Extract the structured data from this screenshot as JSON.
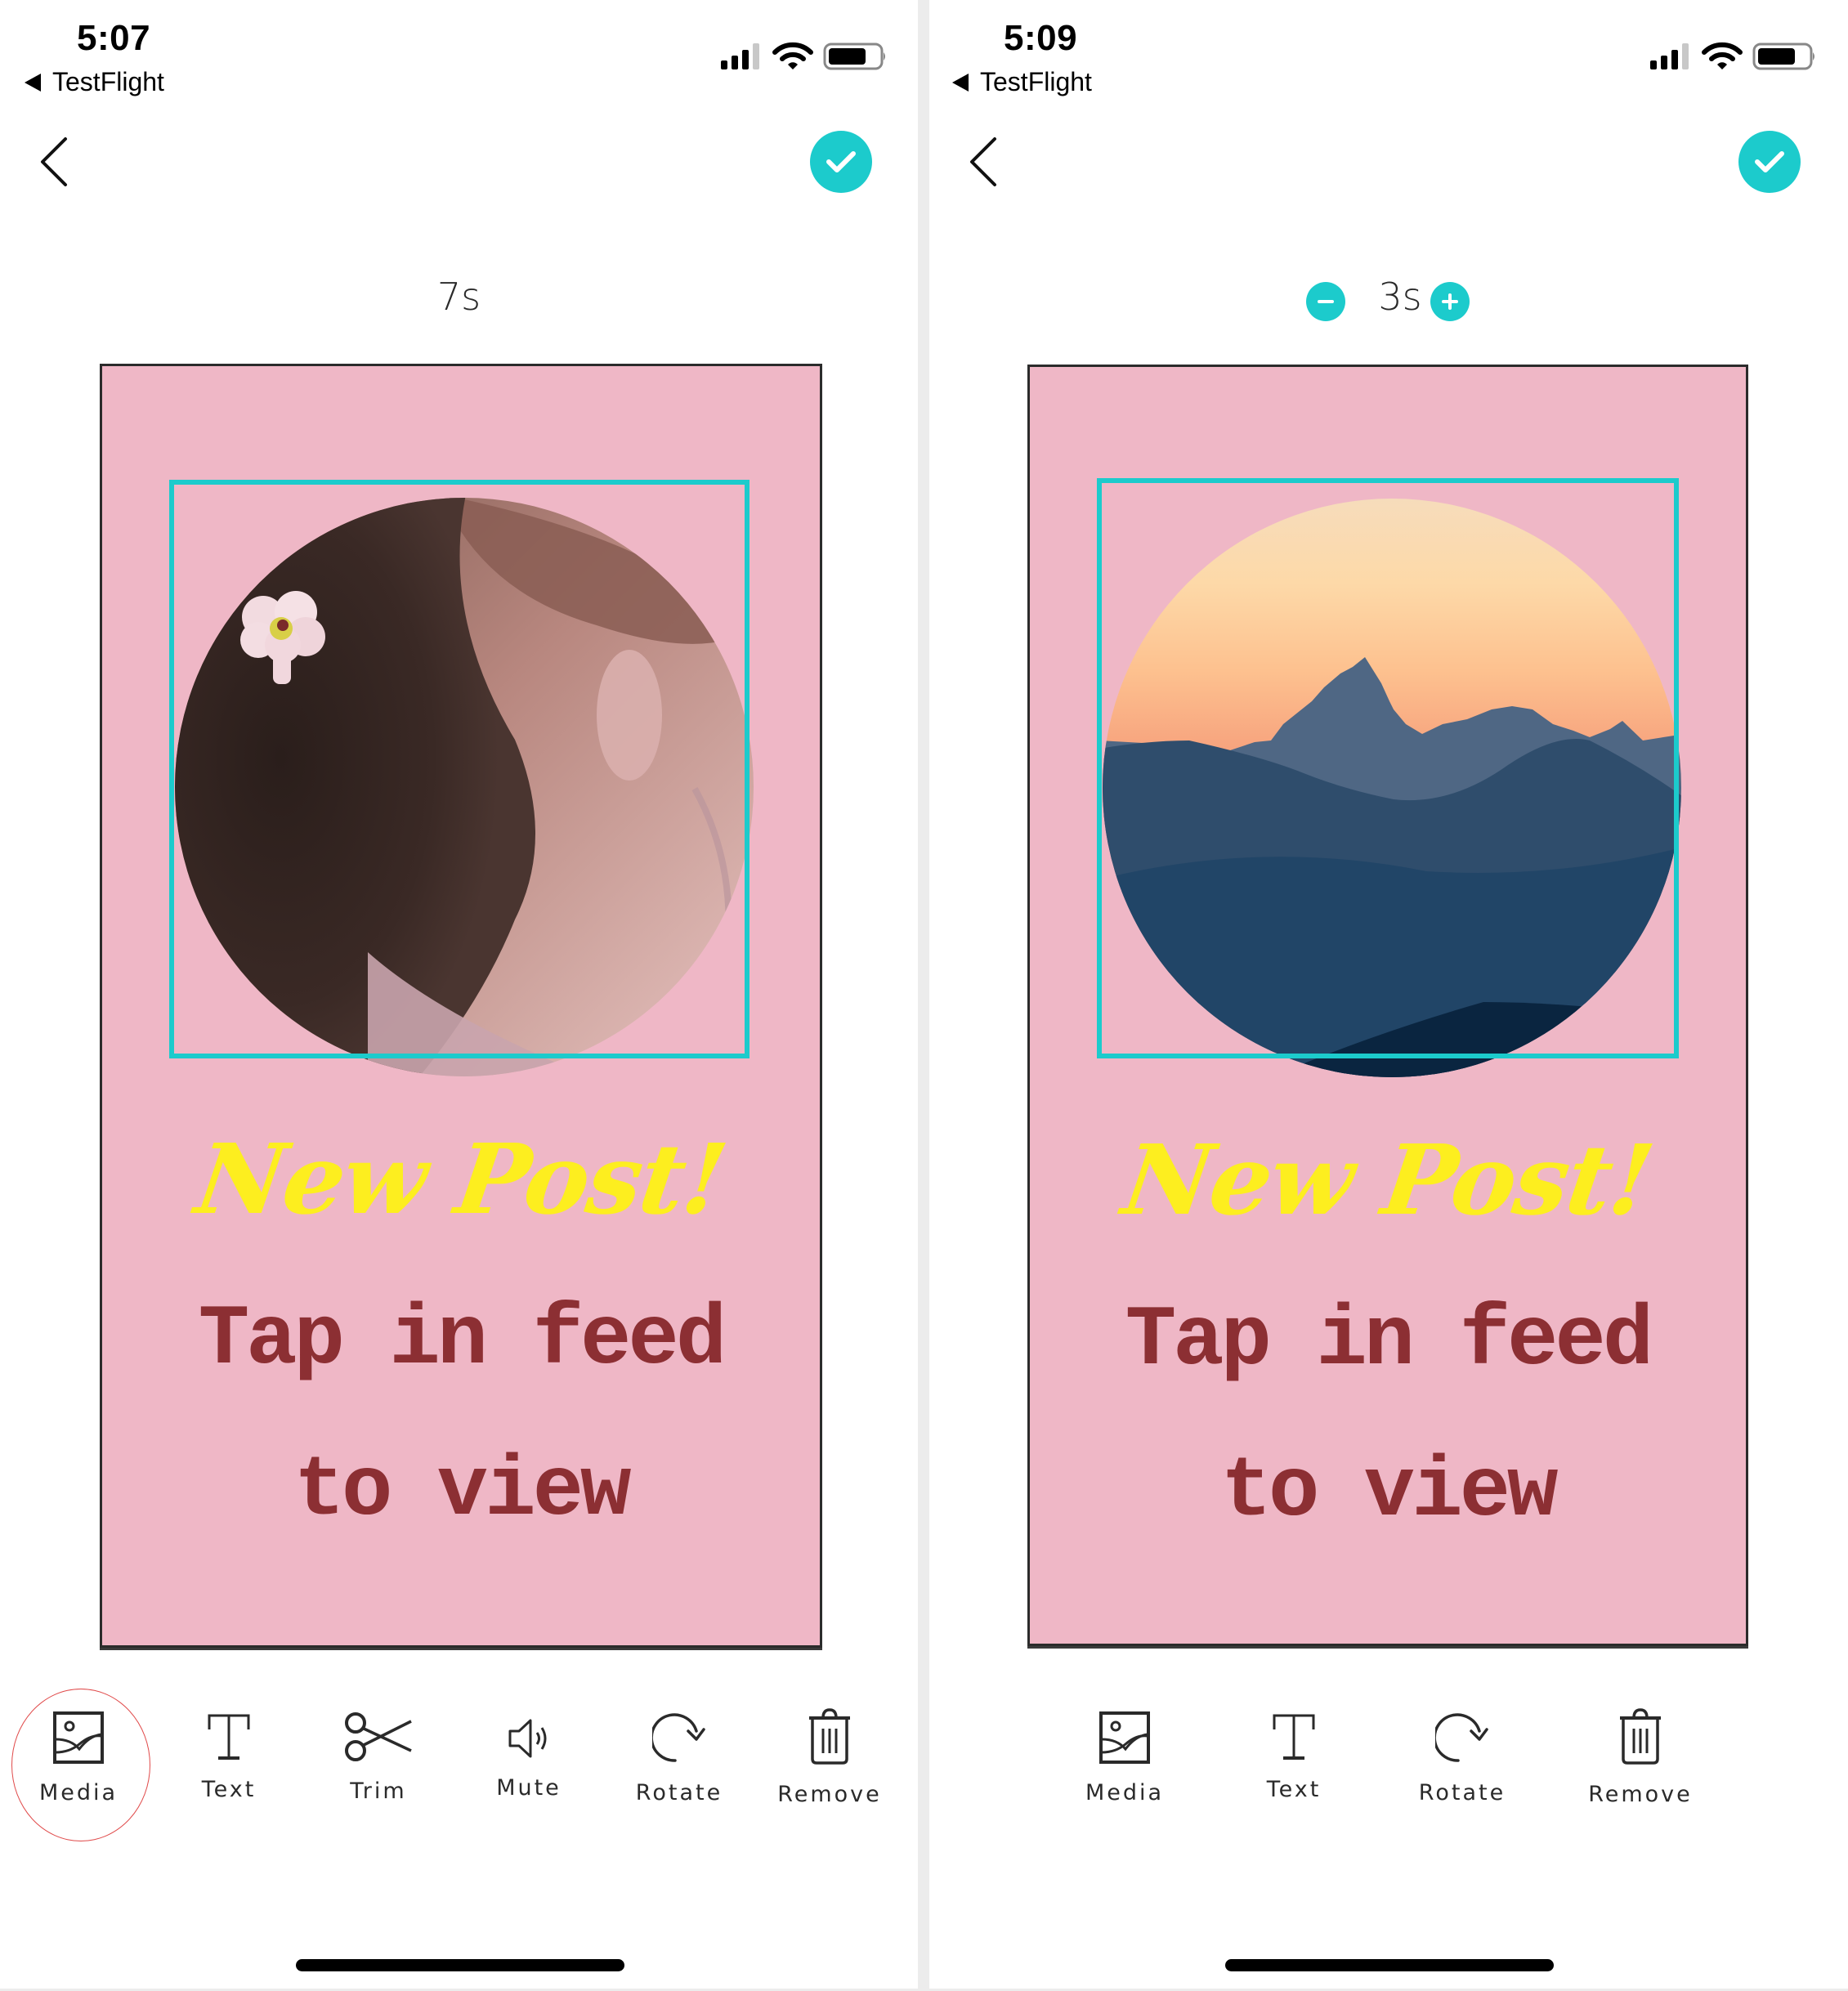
{
  "screens": [
    {
      "status_bar": {
        "time": "5:07",
        "back_app": "TestFlight"
      },
      "nav": {
        "back_icon": "chevron-left-icon",
        "confirm_icon": "checkmark-icon"
      },
      "duration": {
        "value": "7s",
        "has_stepper": false
      },
      "story": {
        "background_color": "#efb7c6",
        "media_description": "circular photo: curly dark hair with a pink flower, neck and shoulder",
        "headline": "New Post!",
        "headline_color": "#fdee1f",
        "body_line_1": "Tap in feed",
        "body_line_2": "to view",
        "body_color": "#8c2f33",
        "selection_color": "#1ccbcc"
      },
      "toolbar": [
        {
          "label": "Media",
          "icon": "image-icon",
          "highlighted": true
        },
        {
          "label": "Text",
          "icon": "text-icon"
        },
        {
          "label": "Trim",
          "icon": "scissors-icon"
        },
        {
          "label": "Mute",
          "icon": "speaker-icon"
        },
        {
          "label": "Rotate",
          "icon": "rotate-icon"
        },
        {
          "label": "Remove",
          "icon": "trash-icon"
        }
      ]
    },
    {
      "status_bar": {
        "time": "5:09",
        "back_app": "TestFlight"
      },
      "nav": {
        "back_icon": "chevron-left-icon",
        "confirm_icon": "checkmark-icon"
      },
      "duration": {
        "value": "3s",
        "has_stepper": true,
        "decrement_icon": "minus-icon",
        "increment_icon": "plus-icon"
      },
      "story": {
        "background_color": "#efb7c6",
        "media_description": "circular photo: mountain silhouettes at sunset",
        "headline": "New Post!",
        "headline_color": "#fdee1f",
        "body_line_1": "Tap in feed",
        "body_line_2": "to view",
        "body_color": "#8c2f33",
        "selection_color": "#1ccbcc"
      },
      "toolbar": [
        {
          "label": "Media",
          "icon": "image-icon"
        },
        {
          "label": "Text",
          "icon": "text-icon"
        },
        {
          "label": "Rotate",
          "icon": "rotate-icon"
        },
        {
          "label": "Remove",
          "icon": "trash-icon"
        }
      ]
    }
  ],
  "accent_color": "#1ccbcc"
}
